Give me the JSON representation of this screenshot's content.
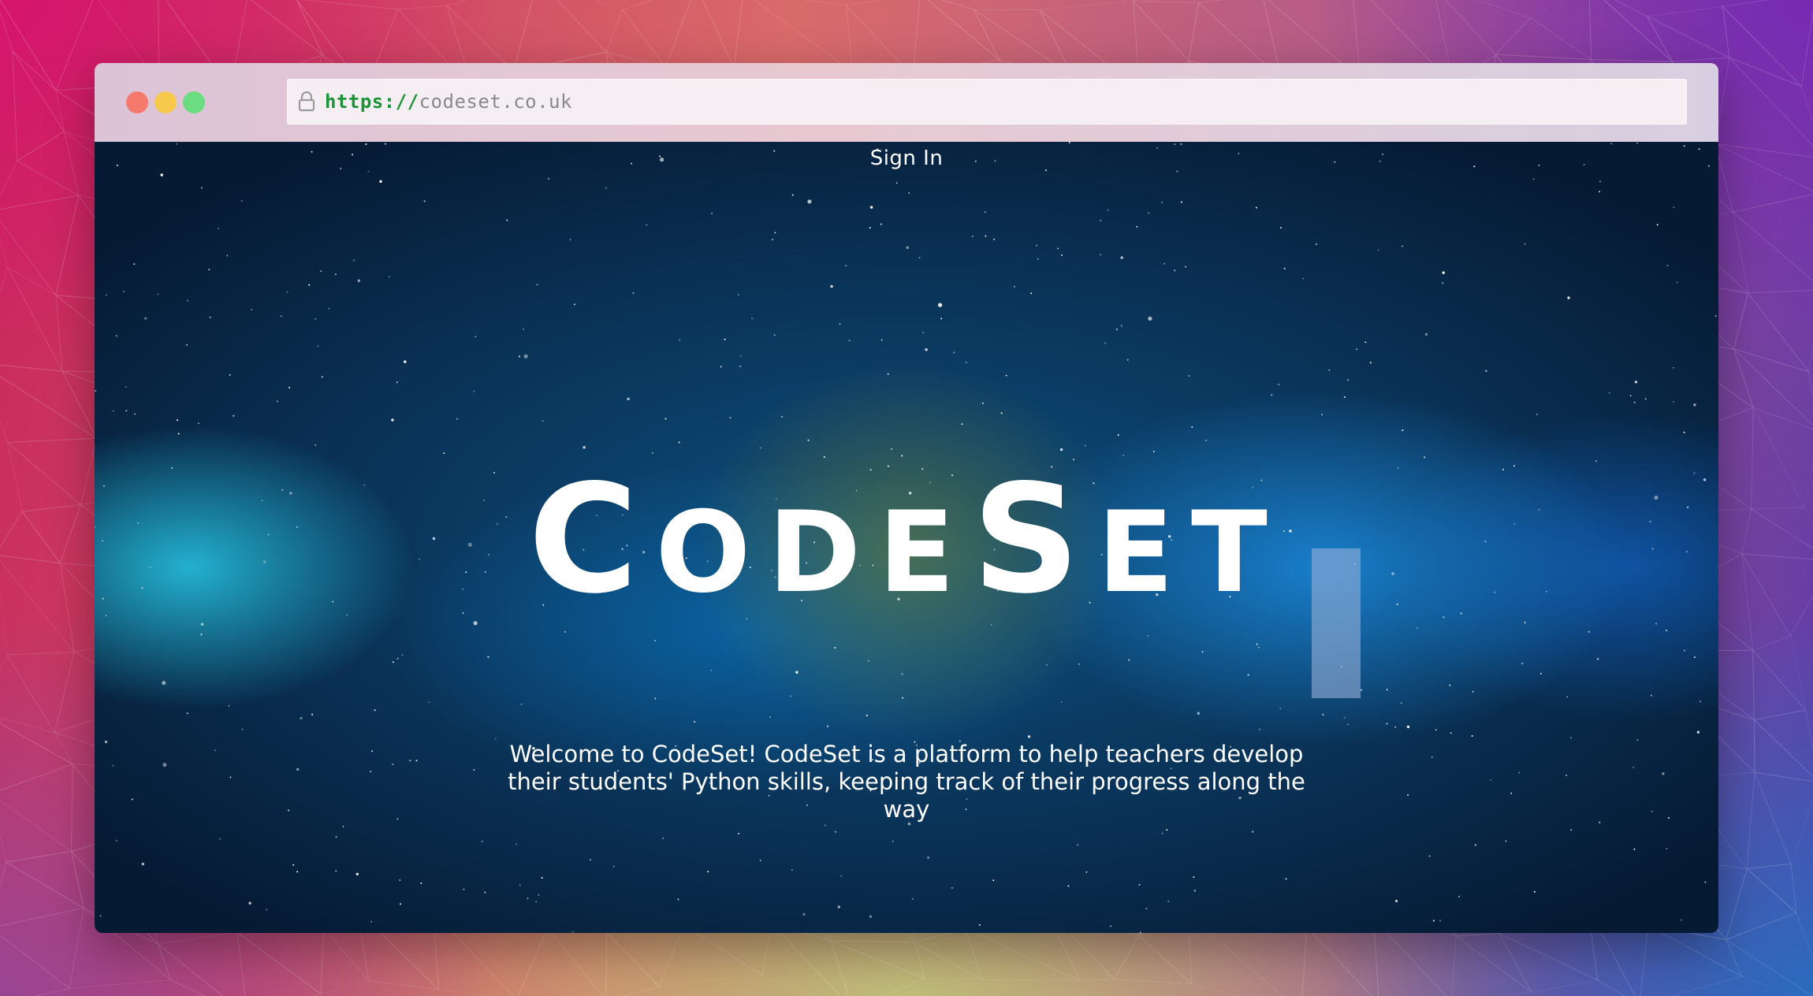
{
  "browser": {
    "url_scheme": "https://",
    "url_host": "codeset.co.uk"
  },
  "page": {
    "nav": {
      "signin_label": "Sign In"
    },
    "hero": {
      "title_first": "C",
      "title_part1": "ODE",
      "title_mid": "S",
      "title_part2": "ET",
      "tagline": "Welcome to CodeSet! CodeSet is a platform to help teachers develop their students' Python skills, keeping track of their progress along the way"
    }
  },
  "colors": {
    "url_scheme": "#1a9436",
    "url_host": "#8a8a8a",
    "traffic_red": "#f6796d",
    "traffic_yellow": "#f7c84c",
    "traffic_green": "#6bdc80",
    "hero_text": "#ffffff"
  },
  "icons": {
    "lock": "lock-icon",
    "scroll_down": "chevron-down-icon"
  }
}
